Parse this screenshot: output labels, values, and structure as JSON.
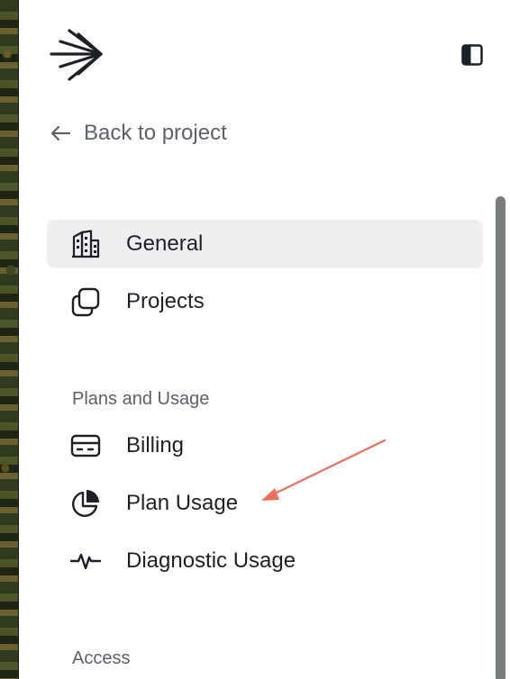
{
  "sidebar": {
    "logo_icon": "asterisk-burst-logo",
    "collapse_icon": "sidebar-toggle-icon",
    "back_link": "Back to project",
    "items": [
      {
        "label": "General",
        "icon": "building-icon",
        "active": true
      },
      {
        "label": "Projects",
        "icon": "stacked-squares-icon",
        "active": false
      }
    ],
    "sections": [
      {
        "label": "Plans and Usage",
        "items": [
          {
            "label": "Billing",
            "icon": "credit-card-icon"
          },
          {
            "label": "Plan Usage",
            "icon": "pie-chart-icon"
          },
          {
            "label": "Diagnostic Usage",
            "icon": "activity-pulse-icon"
          }
        ]
      },
      {
        "label": "Access",
        "items": []
      }
    ]
  },
  "colors": {
    "text": "#1d2127",
    "muted": "#5c6069",
    "active_bg": "#eeeff1",
    "annotation": "#e8705c"
  }
}
